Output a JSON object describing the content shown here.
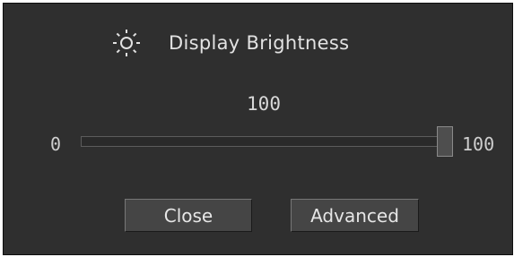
{
  "dialog": {
    "title": "Display Brightness",
    "icon": "sun-icon"
  },
  "brightness": {
    "value": 100,
    "value_text": "100",
    "min": 0,
    "max": 100,
    "min_label": "0",
    "max_label": "100"
  },
  "buttons": {
    "close_label": "Close",
    "advanced_label": "Advanced"
  },
  "colors": {
    "background": "#2f2f2f",
    "text": "#e2e2e2",
    "button": "#454545"
  }
}
